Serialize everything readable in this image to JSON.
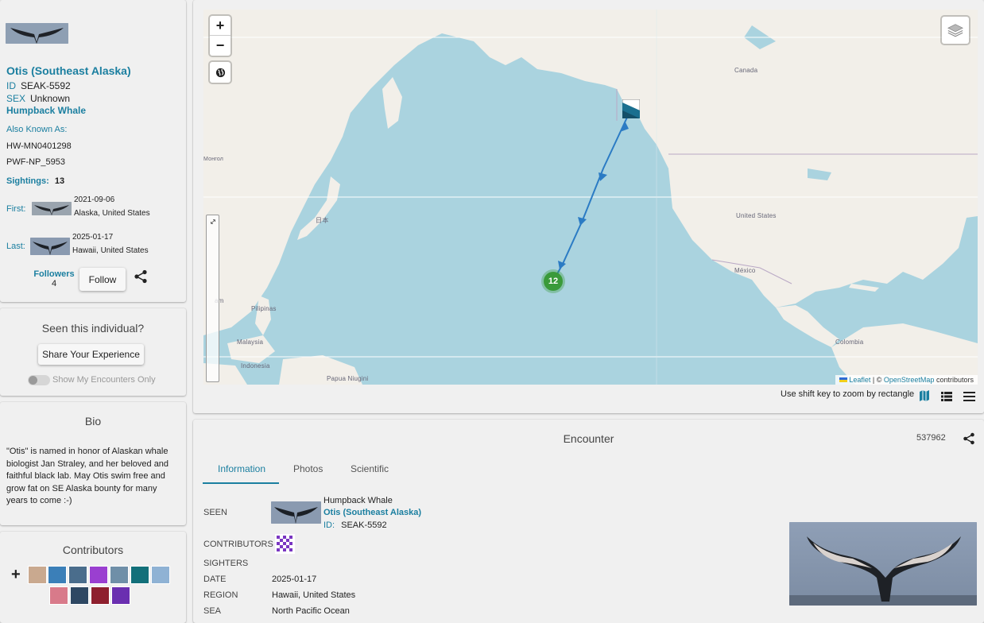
{
  "profile": {
    "name": "Otis (Southeast Alaska)",
    "id_label": "ID",
    "id_value": "SEAK-5592",
    "sex_label": "SEX",
    "sex_value": "Unknown",
    "species": "Humpback Whale",
    "aka_label": "Also Known As:",
    "aka": [
      "HW-MN0401298",
      "PWF-NP_5953"
    ],
    "sightings_label": "Sightings:",
    "sightings_count": "13",
    "first_label": "First:",
    "first_date": "2021-09-06",
    "first_location": "Alaska, United States",
    "last_label": "Last:",
    "last_date": "2025-01-17",
    "last_location": "Hawaii, United States",
    "followers_label": "Followers",
    "followers_count": "4",
    "follow_button": "Follow"
  },
  "seen": {
    "title": "Seen this individual?",
    "share_button": "Share Your Experience",
    "toggle_label": "Show My Encounters Only"
  },
  "bio": {
    "title": "Bio",
    "text": "\"Otis\" is named in honor of Alaskan whale biologist Jan Straley, and her beloved and faithful black lab. May Otis swim free and grow fat on SE Alaska bounty for many years to come :-)"
  },
  "contributors": {
    "title": "Contributors",
    "add_symbol": "+"
  },
  "map": {
    "zoom_in": "+",
    "zoom_out": "−",
    "labels": {
      "canada": "Canada",
      "usa": "United States",
      "mexico": "México",
      "japan": "日本",
      "philippines": "Pilipinas",
      "malaysia": "Malaysia",
      "indonesia": "Indonesia",
      "png": "Papua Niugini",
      "colombia": "Colombia",
      "mongolia": "Монгол",
      "vietnam": "am"
    },
    "cluster_count": "12",
    "attribution_leaflet": "Leaflet",
    "attribution_osm": "OpenStreetMap",
    "attribution_rest": "contributors",
    "hint": "Use shift key to zoom by rectangle"
  },
  "encounter": {
    "title": "Encounter",
    "number": "537962",
    "tabs": [
      "Information",
      "Photos",
      "Scientific"
    ],
    "seen_label": "SEEN",
    "seen_species": "Humpback Whale",
    "seen_name": "Otis (Southeast Alaska)",
    "seen_id_label": "ID:",
    "seen_id_value": "SEAK-5592",
    "contributors_label": "CONTRIBUTORS",
    "sighters_label": "SIGHTERS",
    "date_label": "DATE",
    "date_value": "2025-01-17",
    "region_label": "REGION",
    "region_value": "Hawaii, United States",
    "sea_label": "SEA",
    "sea_value": "North Pacific Ocean"
  },
  "colors": {
    "accent": "#1b7fa0",
    "cluster": "#3a9a3a",
    "track": "#2b7bc4"
  }
}
